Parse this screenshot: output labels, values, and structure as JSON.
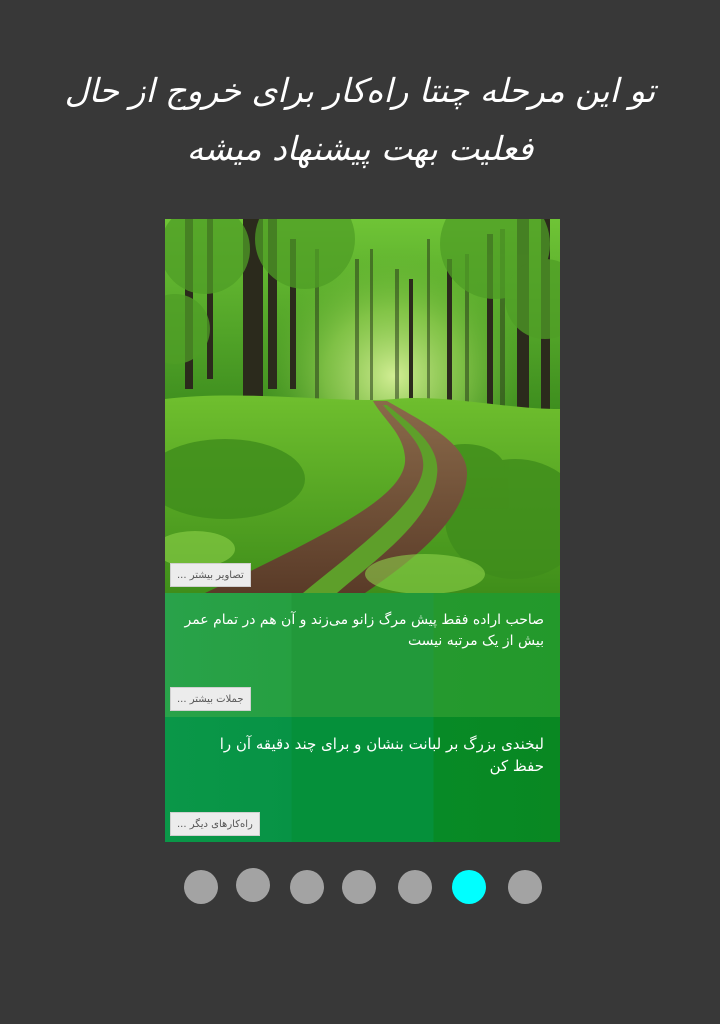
{
  "header": {
    "title": "تو این مرحله چنتا راه‌کار برای خروج از حال فعلیت بهت پیشنهاد میشه"
  },
  "card": {
    "photo": {
      "image": "forest-dirt-road-photo",
      "button_label": "تصاویر بیشتر ..."
    },
    "quote_tile": {
      "text": "صاحب اراده فقط پیش مرگ زانو می‌زند و آن هم در تمام عمر بیش از یک مرتبه نیست",
      "button_label": "جملات بیشتر ...",
      "color": "#24a03e"
    },
    "tip_tile": {
      "text": "لبخندی بزرگ بر لبانت بنشان و برای چند دقیقه آن را حفظ کن",
      "button_label": "راه‌کارهای دیگر ...",
      "color": "#07903a"
    }
  },
  "pager": {
    "count": 7,
    "active_index": 5,
    "active_color": "#00ffff",
    "inactive_color": "#a3a3a3"
  }
}
